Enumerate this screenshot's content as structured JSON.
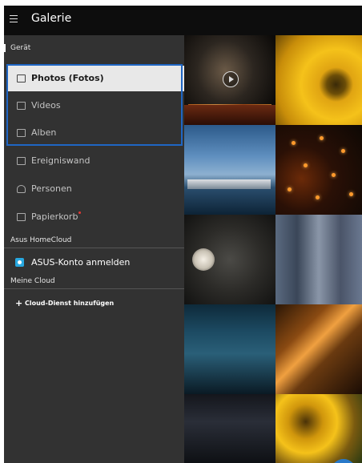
{
  "app": {
    "title": "Galerie"
  },
  "drawer": {
    "device_section": "Gerät",
    "items": [
      {
        "label": "Photos (Fotos)",
        "icon": "photos-icon",
        "active": true
      },
      {
        "label": "Videos",
        "icon": "videos-icon",
        "active": false
      },
      {
        "label": "Alben",
        "icon": "albums-icon",
        "active": false
      },
      {
        "label": "Ereigniswand",
        "icon": "event-wall-icon",
        "active": false
      },
      {
        "label": "Personen",
        "icon": "people-icon",
        "active": false
      },
      {
        "label": "Papierkorb",
        "icon": "trash-icon",
        "active": false,
        "badge": true
      }
    ],
    "homecloud_section": "Asus HomeCloud",
    "asus_account_label": "ASUS-Konto anmelden",
    "mycloud_section": "Meine Cloud",
    "add_cloud_label": "Cloud-Dienst hinzufügen",
    "add_cloud_prefix": "+"
  },
  "fab": {
    "symbol": "+"
  },
  "colors": {
    "accent": "#1f66c4",
    "asus_blue": "#28a8e0",
    "drawer_bg": "#323232",
    "appbar_bg": "#0d0d0d"
  }
}
